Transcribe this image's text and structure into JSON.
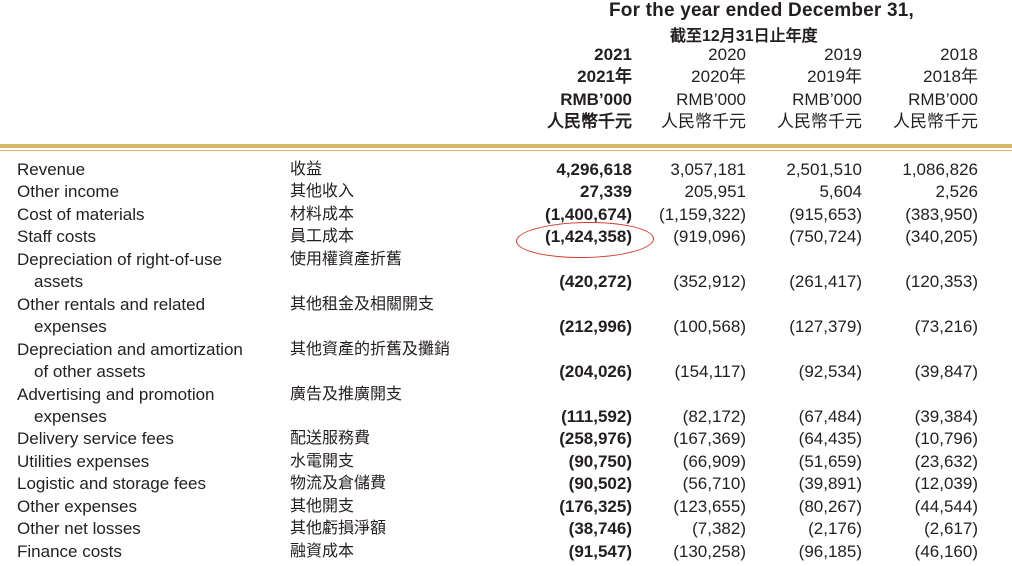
{
  "header": {
    "title": "For the year ended December 31,",
    "title_zh": "截至12月31日止年度",
    "columns": [
      {
        "year": "2021",
        "year_zh": "2021年",
        "unit": "RMB’000",
        "unit_zh": "人民幣千元"
      },
      {
        "year": "2020",
        "year_zh": "2020年",
        "unit": "RMB’000",
        "unit_zh": "人民幣千元"
      },
      {
        "year": "2019",
        "year_zh": "2019年",
        "unit": "RMB’000",
        "unit_zh": "人民幣千元"
      },
      {
        "year": "2018",
        "year_zh": "2018年",
        "unit": "RMB’000",
        "unit_zh": "人民幣千元"
      }
    ]
  },
  "rows": [
    {
      "en": "Revenue",
      "zh": "收益",
      "values": [
        "4,296,618",
        "3,057,181",
        "2,501,510",
        "1,086,826"
      ]
    },
    {
      "en": "Other income",
      "zh": "其他收入",
      "values": [
        "27,339",
        "205,951",
        "5,604",
        "2,526"
      ]
    },
    {
      "en": "Cost of materials",
      "zh": "材料成本",
      "values": [
        "(1,400,674)",
        "(1,159,322)",
        "(915,653)",
        "(383,950)"
      ]
    },
    {
      "en": "Staff costs",
      "zh": "員工成本",
      "values": [
        "(1,424,358)",
        "(919,096)",
        "(750,724)",
        "(340,205)"
      ]
    },
    {
      "en": "Depreciation of right-of-use",
      "en2": "assets",
      "zh": "使用權資產折舊",
      "values": [
        "(420,272)",
        "(352,912)",
        "(261,417)",
        "(120,353)"
      ]
    },
    {
      "en": "Other rentals and related",
      "en2": "expenses",
      "zh": "其他租金及相關開支",
      "values": [
        "(212,996)",
        "(100,568)",
        "(127,379)",
        "(73,216)"
      ]
    },
    {
      "en": "Depreciation and amortization",
      "en2": "of other assets",
      "zh": "其他資產的折舊及攤銷",
      "values": [
        "(204,026)",
        "(154,117)",
        "(92,534)",
        "(39,847)"
      ]
    },
    {
      "en": "Advertising and promotion",
      "en2": "expenses",
      "zh": "廣告及推廣開支",
      "values": [
        "(111,592)",
        "(82,172)",
        "(67,484)",
        "(39,384)"
      ]
    },
    {
      "en": "Delivery service fees",
      "zh": "配送服務費",
      "values": [
        "(258,976)",
        "(167,369)",
        "(64,435)",
        "(10,796)"
      ]
    },
    {
      "en": "Utilities expenses",
      "zh": "水電開支",
      "values": [
        "(90,750)",
        "(66,909)",
        "(51,659)",
        "(23,632)"
      ]
    },
    {
      "en": "Logistic and storage fees",
      "zh": "物流及倉儲費",
      "values": [
        "(90,502)",
        "(56,710)",
        "(39,891)",
        "(12,039)"
      ]
    },
    {
      "en": "Other expenses",
      "zh": "其他開支",
      "values": [
        "(176,325)",
        "(123,655)",
        "(80,267)",
        "(44,544)"
      ]
    },
    {
      "en": "Other net losses",
      "zh": "其他虧損淨額",
      "values": [
        "(38,746)",
        "(7,382)",
        "(2,176)",
        "(2,617)"
      ]
    },
    {
      "en": "Finance costs",
      "zh": "融資成本",
      "values": [
        "(91,547)",
        "(130,258)",
        "(96,185)",
        "(46,160)"
      ]
    }
  ],
  "colors": {
    "rule": "#d7b96a",
    "highlight": "#d2392e",
    "text": "#231f20"
  }
}
